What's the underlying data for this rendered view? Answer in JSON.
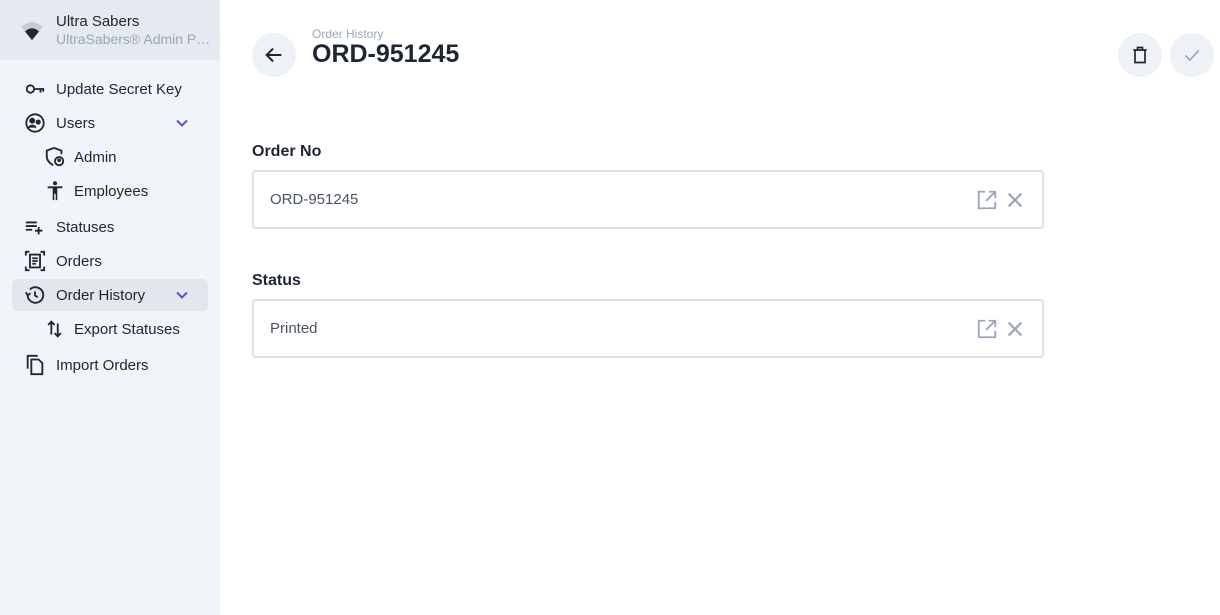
{
  "brand": {
    "title": "Ultra Sabers",
    "subtitle": "UltraSabers® Admin Panel",
    "icon": "wifi-icon"
  },
  "sidebar": {
    "items": [
      {
        "label": "Update Secret Key",
        "icon": "key-icon"
      },
      {
        "label": "Users",
        "icon": "users-icon",
        "expanded": true
      },
      {
        "label": "Admin",
        "icon": "admin-shield-icon"
      },
      {
        "label": "Employees",
        "icon": "person-icon"
      },
      {
        "label": "Statuses",
        "icon": "playlist-add-icon"
      },
      {
        "label": "Orders",
        "icon": "document-scan-icon"
      },
      {
        "label": "Order History",
        "icon": "history-icon",
        "expanded": true,
        "active": true
      },
      {
        "label": "Export Statuses",
        "icon": "swap-vertical-icon"
      },
      {
        "label": "Import Orders",
        "icon": "copy-icon"
      }
    ]
  },
  "header": {
    "breadcrumb": "Order History",
    "title": "ORD-951245"
  },
  "fields": [
    {
      "label": "Order No",
      "value": "ORD-951245"
    },
    {
      "label": "Status",
      "value": "Printed"
    }
  ],
  "colors": {
    "accent": "#5b4fd9",
    "sidebar_bg": "#f1f4f9",
    "active_bg": "#e2e7ee",
    "muted_icon": "#9aa6b9"
  }
}
